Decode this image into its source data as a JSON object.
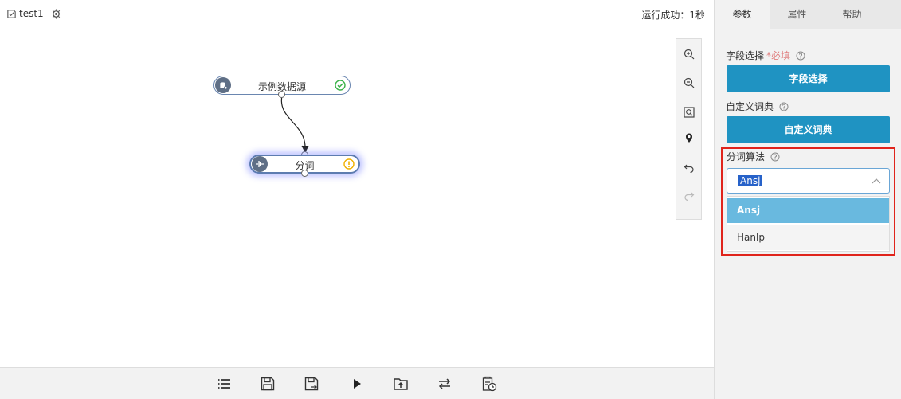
{
  "header": {
    "flow_name": "test1",
    "status": "运行成功：1秒"
  },
  "canvas": {
    "nodes": [
      {
        "id": "source",
        "label": "示例数据源",
        "status": "success"
      },
      {
        "id": "fenci",
        "label": "分词",
        "status": "warning"
      }
    ]
  },
  "zoom_toolbar": {
    "buttons": [
      "zoom-in-icon",
      "zoom-out-icon",
      "fit-view-icon",
      "locate-icon",
      "undo-icon",
      "redo-icon"
    ]
  },
  "bottom_toolbar": {
    "buttons": [
      "list-icon",
      "save-icon",
      "save-as-icon",
      "run-icon",
      "export-icon",
      "swap-icon",
      "schedule-icon"
    ]
  },
  "panel": {
    "tabs": [
      {
        "label": "参数",
        "active": true
      },
      {
        "label": "属性",
        "active": false
      },
      {
        "label": "帮助",
        "active": false
      }
    ],
    "field_select": {
      "label": "字段选择",
      "required": "*必填",
      "button": "字段选择"
    },
    "custom_dict": {
      "label": "自定义词典",
      "button": "自定义词典"
    },
    "algorithm": {
      "label": "分词算法",
      "selected": "Ansj",
      "options": [
        "Ansj",
        "Hanlp"
      ]
    }
  },
  "colors": {
    "primary_button": "#1f93c2",
    "highlight_box": "#e0241c",
    "selected_option": "#69b9df"
  }
}
